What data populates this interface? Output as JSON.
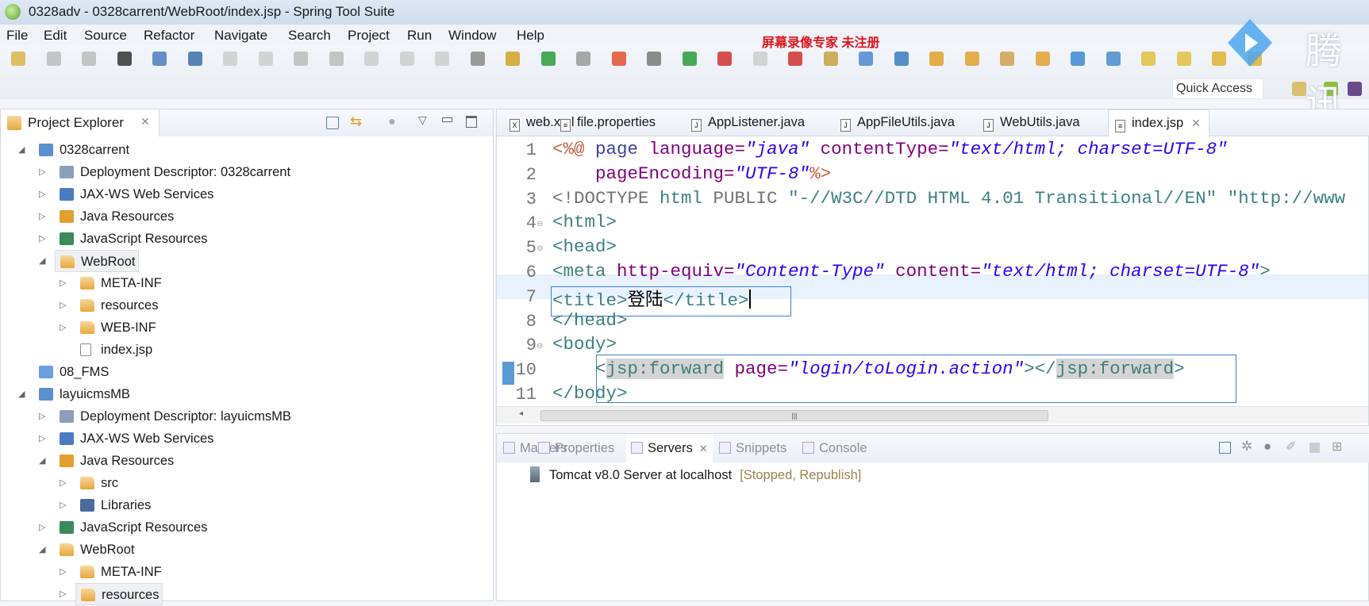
{
  "window": {
    "title": "0328adv - 0328carrent/WebRoot/index.jsp - Spring Tool Suite"
  },
  "menu": [
    "File",
    "Edit",
    "Source",
    "Refactor",
    "Navigate",
    "Search",
    "Project",
    "Run",
    "Window",
    "Help"
  ],
  "watermark": {
    "recorder": "屏幕录像专家  未注册",
    "logo_text": "腾讯"
  },
  "quick_access": "Quick Access",
  "project_explorer": {
    "title": "Project Explorer",
    "items": [
      {
        "label": "0328carrent",
        "level": 0,
        "state": "expanded",
        "icon": "project-icon"
      },
      {
        "label": "Deployment Descriptor: 0328carrent",
        "level": 1,
        "state": "collapsed",
        "icon": "deployment-descriptor-icon"
      },
      {
        "label": "JAX-WS Web Services",
        "level": 1,
        "state": "collapsed",
        "icon": "web-services-icon"
      },
      {
        "label": "Java Resources",
        "level": 1,
        "state": "collapsed",
        "icon": "java-resources-icon"
      },
      {
        "label": "JavaScript Resources",
        "level": 1,
        "state": "collapsed",
        "icon": "javascript-resources-icon"
      },
      {
        "label": "WebRoot",
        "level": 1,
        "state": "expanded",
        "icon": "folder-icon",
        "selected": true
      },
      {
        "label": "META-INF",
        "level": 2,
        "state": "collapsed",
        "icon": "folder-icon"
      },
      {
        "label": "resources",
        "level": 2,
        "state": "collapsed",
        "icon": "folder-icon"
      },
      {
        "label": "WEB-INF",
        "level": 2,
        "state": "collapsed",
        "icon": "folder-icon"
      },
      {
        "label": "index.jsp",
        "level": 2,
        "state": "leaf",
        "icon": "file-icon"
      },
      {
        "label": "08_FMS",
        "level": 0,
        "state": "leaf",
        "icon": "closed-project-icon"
      },
      {
        "label": "layuicmsMB",
        "level": 0,
        "state": "expanded",
        "icon": "project-icon"
      },
      {
        "label": "Deployment Descriptor: layuicmsMB",
        "level": 1,
        "state": "collapsed",
        "icon": "deployment-descriptor-icon"
      },
      {
        "label": "JAX-WS Web Services",
        "level": 1,
        "state": "collapsed",
        "icon": "web-services-icon"
      },
      {
        "label": "Java Resources",
        "level": 1,
        "state": "expanded",
        "icon": "java-resources-icon"
      },
      {
        "label": "src",
        "level": 2,
        "state": "collapsed",
        "icon": "package-folder-icon"
      },
      {
        "label": "Libraries",
        "level": 2,
        "state": "collapsed",
        "icon": "libraries-icon"
      },
      {
        "label": "JavaScript Resources",
        "level": 1,
        "state": "collapsed",
        "icon": "javascript-resources-icon"
      },
      {
        "label": "WebRoot",
        "level": 1,
        "state": "expanded",
        "icon": "folder-icon"
      },
      {
        "label": "META-INF",
        "level": 2,
        "state": "collapsed",
        "icon": "folder-icon"
      },
      {
        "label": "resources",
        "level": 2,
        "state": "collapsed",
        "icon": "folder-icon",
        "selected": true
      }
    ]
  },
  "editor": {
    "tabs": [
      {
        "label": "web.xml",
        "icon": "X"
      },
      {
        "label": "file.properties",
        "icon": "≡"
      },
      {
        "label": "AppListener.java",
        "icon": "J"
      },
      {
        "label": "AppFileUtils.java",
        "icon": "J"
      },
      {
        "label": "WebUtils.java",
        "icon": "J"
      },
      {
        "label": "index.jsp",
        "icon": "≡",
        "active": true
      }
    ],
    "current_line": 7,
    "lines": [
      {
        "n": "1",
        "tokens": [
          [
            "<%@ ",
            "dir"
          ],
          [
            "page ",
            "kw"
          ],
          [
            "language=",
            "attr"
          ],
          [
            "\"java\"",
            "val"
          ],
          [
            " contentType=",
            "attr"
          ],
          [
            "\"text/html; charset=UTF-8\"",
            "val"
          ]
        ]
      },
      {
        "n": "2",
        "tokens": [
          [
            "    pageEncoding=",
            "attr"
          ],
          [
            "\"UTF-8\"",
            "val"
          ],
          [
            "%>",
            "dir"
          ]
        ]
      },
      {
        "n": "3",
        "tokens": [
          [
            "<!DOCTYPE ",
            "doc"
          ],
          [
            "html ",
            "tag"
          ],
          [
            "PUBLIC ",
            "doc"
          ],
          [
            "\"-//W3C//DTD HTML 4.01 Transitional//EN\" \"http://www",
            "str"
          ]
        ]
      },
      {
        "n": "4",
        "fold": true,
        "tokens": [
          [
            "<html>",
            "tag"
          ]
        ]
      },
      {
        "n": "5",
        "fold": true,
        "tokens": [
          [
            "<head>",
            "tag"
          ]
        ]
      },
      {
        "n": "6",
        "tokens": [
          [
            "<meta ",
            "tag"
          ],
          [
            "http-equiv=",
            "attr"
          ],
          [
            "\"Content-Type\"",
            "val"
          ],
          [
            " content=",
            "attr"
          ],
          [
            "\"text/html; charset=UTF-8\"",
            "val"
          ],
          [
            ">",
            "tag"
          ]
        ]
      },
      {
        "n": "7",
        "tokens": [
          [
            "<title>",
            "tag"
          ],
          [
            "登陆",
            "txt"
          ],
          [
            "</title>",
            "tag"
          ]
        ]
      },
      {
        "n": "8",
        "tokens": [
          [
            "</head>",
            "tag"
          ]
        ]
      },
      {
        "n": "9",
        "fold": true,
        "tokens": [
          [
            "<body>",
            "tag"
          ]
        ]
      },
      {
        "n": "10",
        "tokens": [
          [
            "    <",
            "tag"
          ],
          [
            "jsp:forward",
            "hl"
          ],
          [
            " page=",
            "attr"
          ],
          [
            "\"login/toLogin.action\"",
            "val"
          ],
          [
            "></",
            "tag"
          ],
          [
            "jsp:forward",
            "hl"
          ],
          [
            ">",
            "tag"
          ]
        ]
      },
      {
        "n": "11",
        "tokens": [
          [
            "</body>",
            "tag"
          ]
        ]
      }
    ]
  },
  "bottom_panel": {
    "tabs": [
      {
        "label": "Markers"
      },
      {
        "label": "Properties"
      },
      {
        "label": "Servers",
        "active": true
      },
      {
        "label": "Snippets"
      },
      {
        "label": "Console"
      }
    ],
    "servers": [
      {
        "name": "Tomcat v8.0 Server at localhost",
        "status": "[Stopped, Republish]"
      }
    ]
  }
}
